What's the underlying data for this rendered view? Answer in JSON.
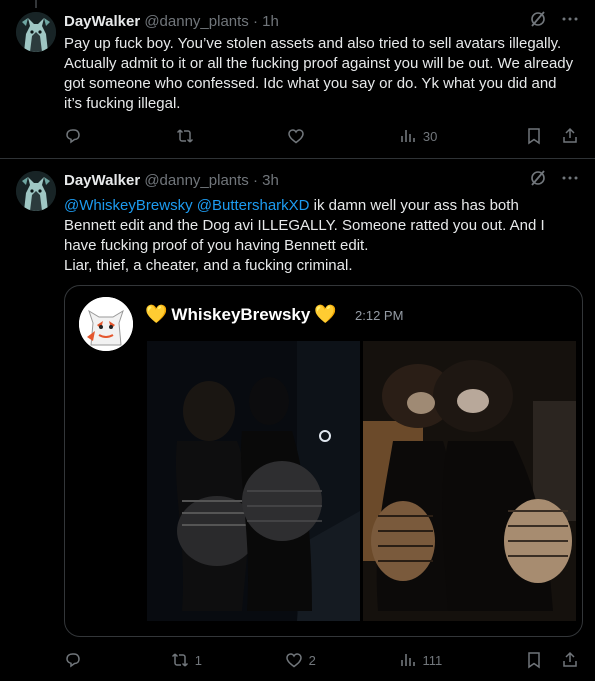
{
  "tweets": [
    {
      "name": "DayWalker",
      "handle": "@danny_plants",
      "dot": "·",
      "time": "1h",
      "text": "Pay up fuck boy. You’ve stolen assets and also tried to sell avatars illegally. Actually admit to it or all the fucking proof against you will be out. We already got someone who confessed. Idc what you say or do. Yk what you did and it’s fucking illegal.",
      "replies": "",
      "retweets": "",
      "likes": "",
      "views": "30"
    },
    {
      "name": "DayWalker",
      "handle": "@danny_plants",
      "dot": "·",
      "time": "3h",
      "mention1": "@WhiskeyBrewsky",
      "mention2": "@ButtersharkXD",
      "text_line1_rest": " ik damn well your ass has both",
      "text_line2": "Bennett edit and the Dog avi ILLEGALLY. Someone ratted you out. And I",
      "text_line3": "have fucking proof of you having Bennett edit.",
      "text_line4": "Liar, thief, a cheater, and a fucking criminal.",
      "replies": "",
      "retweets": "1",
      "likes": "2",
      "views": "111",
      "card": {
        "username": "WhiskeyBrewsky",
        "emoji_left": "💛",
        "emoji_right": "💛",
        "time": "2:12 PM"
      }
    }
  ],
  "icons": {
    "grok": "grok-slash-icon",
    "more": "more-dots-icon",
    "reply": "reply-icon",
    "retweet": "retweet-icon",
    "like": "like-icon",
    "views": "views-icon",
    "bookmark": "bookmark-icon",
    "share": "share-icon"
  },
  "colors": {
    "background": "#000000",
    "text": "#e7e9ea",
    "muted": "#71767b",
    "link": "#1d9bf0",
    "divider": "#2f3336"
  }
}
